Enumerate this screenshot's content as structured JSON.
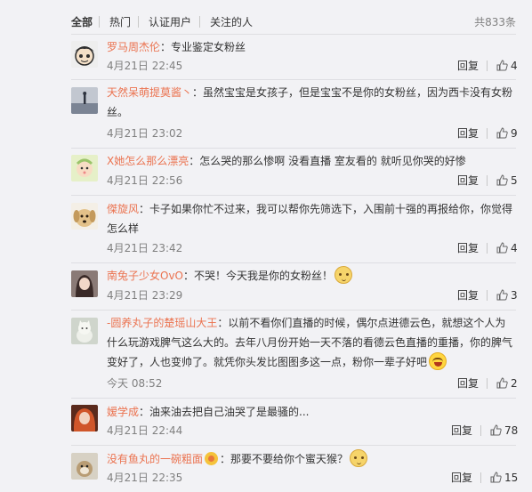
{
  "tabs": [
    {
      "label": "全部",
      "active": true
    },
    {
      "label": "热门",
      "active": false
    },
    {
      "label": "认证用户",
      "active": false
    },
    {
      "label": "关注的人",
      "active": false
    }
  ],
  "total": "共833条",
  "reply_label": "回复",
  "comments": [
    {
      "user": "罗马周杰伦",
      "sep": "：",
      "text": "专业鉴定女粉丝",
      "time": "4月21日 22:45",
      "likes": "4",
      "avatar": "cartoon-boy-icon",
      "avatar_color": "#2e2e2e"
    },
    {
      "user": "天然呆萌提莫酱丶",
      "sep": "：",
      "text": "虽然宝宝是女孩子，但是宝宝不是你的女粉丝，因为西卡没有女粉丝。",
      "time": "4月21日 23:02",
      "likes": "9",
      "avatar": "silhouette-sea-icon",
      "avatar_color": "#8a8f99"
    },
    {
      "user": "X她怎么那么漂亮",
      "sep": "：",
      "text": "怎么哭的那么惨啊 没看直播 室友看的 就听见你哭的好惨",
      "time": "4月21日 22:56",
      "likes": "5",
      "avatar": "cartoon-baby-icon",
      "avatar_color": "#d8e8b0"
    },
    {
      "user": "傑旋风",
      "sep": "：",
      "text": "卡子如果你忙不过来，我可以帮你先筛选下，入围前十强的再报给你，你觉得怎么样",
      "time": "4月21日 23:42",
      "likes": "4",
      "avatar": "puppy-icon",
      "avatar_color": "#d9b77d"
    },
    {
      "user": "南兔子少女OvO",
      "sep": "：",
      "text": "不哭！今天我是你的女粉丝！",
      "emoji": "cat-emoji",
      "time": "4月21日 23:29",
      "likes": "3",
      "avatar": "girl-photo-icon",
      "avatar_color": "#5a4a48"
    },
    {
      "user": "-圆养丸子的楚瑶山大王",
      "sep": "：",
      "text": "以前不看你们直播的时候，偶尔点进德云色，就想这个人为什么玩游戏脾气这么大的。去年八月份开始一天不落的看德云色直播的重播，你的脾气变好了，人也变帅了。就凭你头发比图图多这一点，粉你一辈子好吧",
      "emoji": "laugh-emoji",
      "time": "今天 08:52",
      "likes": "2",
      "avatar": "cat-doll-icon",
      "avatar_color": "#b8c0b4"
    },
    {
      "user": "嫒学成",
      "sep": "：",
      "text": "油来油去把自己油哭了是最骚的...",
      "time": "4月21日 22:44",
      "likes": "78",
      "avatar": "red-hair-girl-icon",
      "avatar_color": "#c4502e"
    },
    {
      "user": "没有鱼丸的一碗粗面",
      "sep": "：",
      "text": "那要不要给你个蜜天猴？",
      "emoji": "cat-emoji",
      "badge": "vip-badge-icon",
      "time": "4月21日 22:35",
      "likes": "15",
      "avatar": "dog-photo-icon",
      "avatar_color": "#c9c1b1"
    }
  ],
  "colors": {
    "background": "#f2f2f5",
    "username": "#eb7350",
    "meta": "#808080",
    "text": "#333333"
  }
}
